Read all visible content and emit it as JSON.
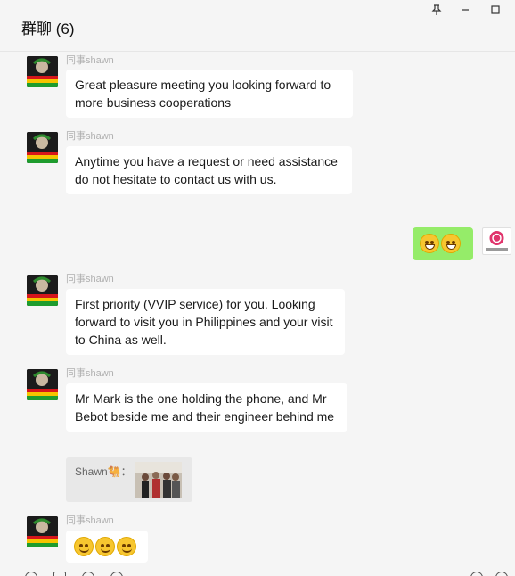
{
  "header": {
    "title": "群聊 (6)"
  },
  "window_controls": {
    "pin": "pin-icon",
    "minimize": "minimize-icon",
    "maximize": "maximize-icon"
  },
  "messages": [
    {
      "sender": "同事shawn",
      "text": "Great pleasure meeting you looking forward to more business cooperations"
    },
    {
      "sender": "同事shawn",
      "text": "Anytime you have a request or need assistance do not hesitate to contact us with us."
    },
    {
      "sender": "",
      "own": true,
      "emoji_count": 2,
      "emoji": "grin"
    },
    {
      "sender": "同事shawn",
      "text": "First priority (VVIP service) for you. Looking forward to visit you in Philippines and your visit to China as well."
    },
    {
      "sender": "同事shawn",
      "text": "Mr Mark is the one holding the phone, and Mr Bebot beside me and their engineer behind me"
    },
    {
      "sender": "",
      "quote": "Shawn🐫："
    },
    {
      "sender": "同事shawn",
      "emoji_count": 3,
      "emoji": "smile"
    }
  ],
  "right_avatar_label": "Rose Lighting",
  "colors": {
    "own_bubble": "#95ec69",
    "other_bubble": "#ffffff",
    "background": "#f5f5f5"
  }
}
